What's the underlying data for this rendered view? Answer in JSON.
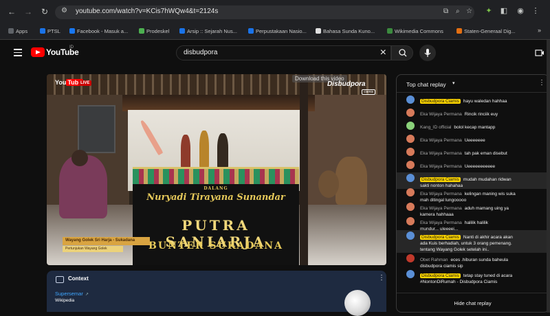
{
  "browser": {
    "url": "youtube.com/watch?v=KCis7hWQw4&t=2124s",
    "bookmarks": [
      {
        "label": "Apps",
        "color": "#5f6368"
      },
      {
        "label": "PTSL",
        "color": "#1a73e8"
      },
      {
        "label": "Facebook - Masuk a...",
        "color": "#1877f2"
      },
      {
        "label": "Prodeskel",
        "color": "#4caf50"
      },
      {
        "label": "Arsip :: Sejarah Nus...",
        "color": "#1a73e8"
      },
      {
        "label": "Perpustakaan Nasio...",
        "color": "#1a73e8"
      },
      {
        "label": "Bahasa Sunda Kuno...",
        "color": "#e0e0e0"
      },
      {
        "label": "Wikimedia Commons",
        "color": "#3b8a3e"
      },
      {
        "label": "Staten-Generaal Dig...",
        "color": "#e36f12"
      }
    ],
    "overflow_label": "»"
  },
  "youtube": {
    "wordmark": "YouTube",
    "country": "ID",
    "search_value": "disbudpora",
    "brand_color": "#ff0000"
  },
  "video": {
    "watermark_you": "You",
    "watermark_tube": "Tube",
    "live_label": "LIVE",
    "download_hint": "Download this video",
    "channel_watermark": "Disbudpora",
    "channel_watermark_sub": "ciamis",
    "banner_small": "DALANG",
    "dalang_name": "Nuryadi Tirayana Sunandar",
    "group_name": "PUTRA SANIARJA",
    "location": "BUNTER SUKADANA",
    "lower_third_title": "Wayang Golek Sri Harja - Sukadana",
    "lower_third_sub": "Pertunjukan Wayang Golek"
  },
  "context": {
    "title": "Context",
    "link_label": "Supersemar",
    "source": "Wikipedia"
  },
  "chat": {
    "title": "Top chat replay",
    "hide_label": "Hide chat replay",
    "owner_color": "#ffd600",
    "messages": [
      {
        "author": "Disbudpora Ciamis",
        "owner": true,
        "lines": [
          "hayu waledan hahhaa"
        ],
        "avatar": "#5a8fd6"
      },
      {
        "author": "Eka Wijaya Permana",
        "owner": false,
        "lines": [
          "Rincik rinciik euy"
        ],
        "avatar": "#d77a5a"
      },
      {
        "author": "Kang_ID official",
        "owner": false,
        "lines": [
          "bolol kecap mantapp"
        ],
        "avatar": "#8ad17a"
      },
      {
        "author": "Eka Wijaya Permana",
        "owner": false,
        "lines": [
          "Ueeeeeee"
        ],
        "avatar": "#d77a5a"
      },
      {
        "author": "Eka Wijaya Permana",
        "owner": false,
        "lines": [
          "tah pak eman disebut"
        ],
        "avatar": "#d77a5a"
      },
      {
        "author": "Eka Wijaya Permana",
        "owner": false,
        "lines": [
          "Ueeeeeeeeeee"
        ],
        "avatar": "#d77a5a"
      },
      {
        "author": "Disbudpora Ciamis",
        "owner": true,
        "lines": [
          "mudah mudahan ridwan",
          "sakti nonton hahahaa"
        ],
        "avatar": "#5a8fd6"
      },
      {
        "author": "Eka Wijaya Permana",
        "owner": false,
        "lines": [
          "kelingan maning wis suka",
          "mah ditingal lungooooo"
        ],
        "avatar": "#d77a5a"
      },
      {
        "author": "Eka Wijaya Permana",
        "owner": false,
        "lines": [
          "aduh mamang uing ya",
          "kamera hahhaaa"
        ],
        "avatar": "#d77a5a"
      },
      {
        "author": "Eka Wijaya Permana",
        "owner": false,
        "lines": [
          "halilik halilik",
          "mundur... uleeeei..."
        ],
        "avatar": "#d77a5a"
      },
      {
        "author": "Disbudpora Ciamis",
        "owner": true,
        "lines": [
          "Nanti di akhir acara akan",
          "ada Kuis berhadiah, untuk 3 orang pemenang.",
          "tentang Wayang Golek setelah ini.."
        ],
        "avatar": "#5a8fd6"
      },
      {
        "author": "Obet Rahman",
        "owner": false,
        "lines": [
          "eces .hiburan sunda baheula",
          "disbudpora ciamis sip"
        ],
        "avatar": "#c0392b"
      },
      {
        "author": "Disbudpora Ciamis",
        "owner": true,
        "lines": [
          "tetap stay tuned di acara",
          "#NontonDiRumah - Disbudpora Ciamis"
        ],
        "avatar": "#5a8fd6"
      }
    ]
  }
}
